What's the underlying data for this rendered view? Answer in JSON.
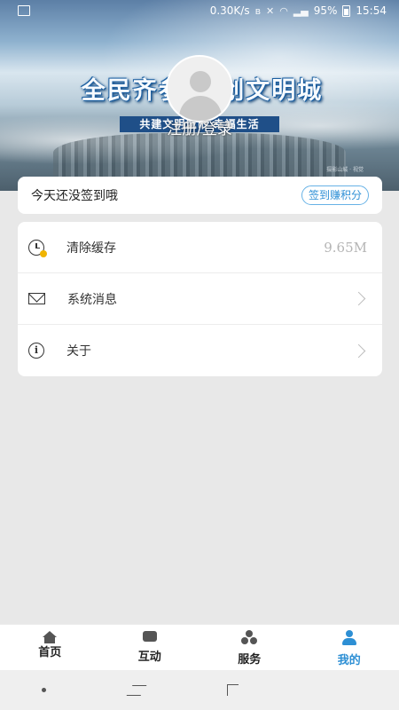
{
  "status_bar": {
    "network_speed": "0.30K/s",
    "battery": "95%",
    "time": "15:54"
  },
  "banner": {
    "slogan": "全民齐参与 创文明城",
    "subslogan": "共建文明城市 幸福生活",
    "credit": "摄影山城 · 视觉"
  },
  "user": {
    "login_label": "注册/登录"
  },
  "signin": {
    "text": "今天还没签到哦",
    "badge": "签到赚积分"
  },
  "menu": {
    "items": [
      {
        "label": "清除缓存",
        "value": "9.65M",
        "icon": "clock-icon"
      },
      {
        "label": "系统消息",
        "icon": "mail-icon"
      },
      {
        "label": "关于",
        "icon": "info-icon"
      }
    ]
  },
  "bottom_nav": {
    "tabs": [
      {
        "label": "首页",
        "icon": "home-icon"
      },
      {
        "label": "互动",
        "icon": "chat-icon"
      },
      {
        "label": "服务",
        "icon": "service-icon"
      },
      {
        "label": "我的",
        "icon": "person-icon",
        "active": true
      }
    ]
  },
  "colors": {
    "accent": "#2d8fd4",
    "page_bg": "#e8e8e8"
  }
}
